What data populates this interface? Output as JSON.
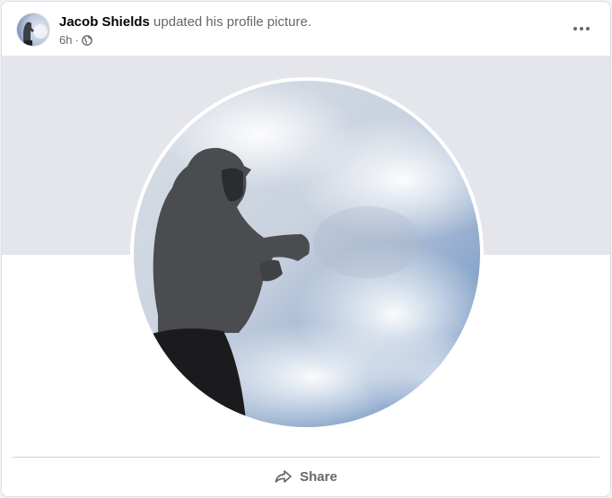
{
  "post": {
    "author": "Jacob Shields",
    "action": "updated his profile picture.",
    "timestamp": "6h",
    "separator": "·",
    "audience_icon": "globe-icon",
    "more_icon": "more-options-icon"
  },
  "media": {
    "cover_color": "#e4e6eb",
    "photo": "profile-picture-hooded-figure-cloudy-sky"
  },
  "actions": {
    "share_label": "Share",
    "share_icon": "share-arrow-icon"
  },
  "colors": {
    "text_primary": "#050505",
    "text_secondary": "#65676b",
    "divider": "#ced0d4"
  }
}
